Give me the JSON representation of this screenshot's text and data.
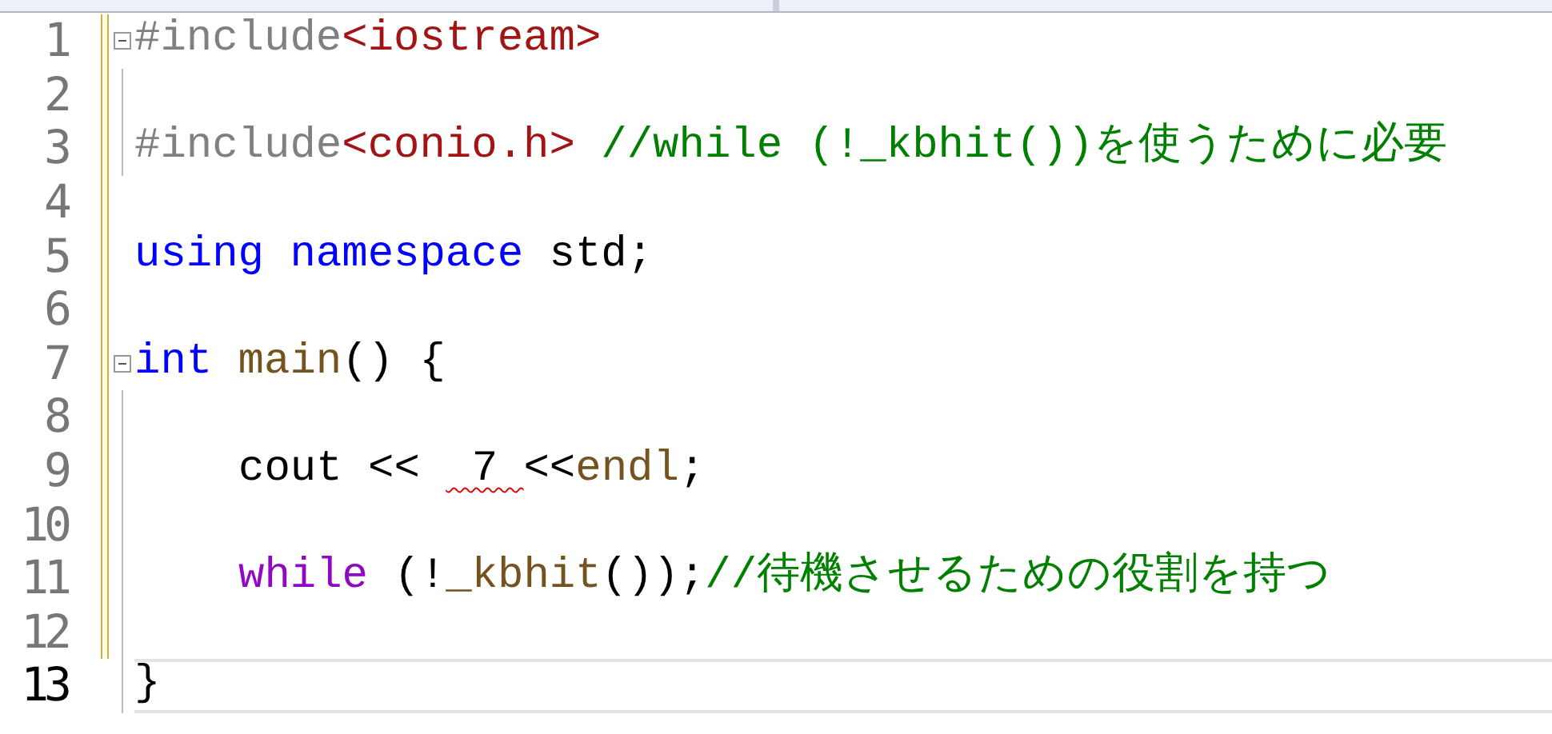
{
  "editor": {
    "lines": [
      {
        "number": "1",
        "changed": true,
        "collapsible": true,
        "current": false,
        "indented": false,
        "segments": [
          {
            "kind": "preprocessor",
            "text": "#include"
          },
          {
            "kind": "string",
            "text": "<iostream>"
          }
        ]
      },
      {
        "number": "2",
        "changed": true,
        "collapsible": false,
        "in_fold": true,
        "current": false,
        "indented": false
      },
      {
        "number": "3",
        "changed": true,
        "collapsible": false,
        "in_fold": true,
        "current": false,
        "indented": false,
        "segments": [
          {
            "kind": "preprocessor",
            "text": "#include"
          },
          {
            "kind": "string",
            "text": "<conio.h>"
          },
          {
            "kind": "comment",
            "text": " //while (!_kbhit())を使うために必要"
          }
        ]
      },
      {
        "number": "4",
        "changed": true,
        "collapsible": false,
        "in_fold": false,
        "current": false,
        "indented": false
      },
      {
        "number": "5",
        "changed": true,
        "collapsible": false,
        "in_fold": false,
        "current": false,
        "indented": false,
        "segments": [
          {
            "kind": "keyword",
            "text": "using"
          },
          {
            "kind": "keyword",
            "text": " namespace"
          },
          {
            "kind": "plain",
            "text": " std;"
          }
        ]
      },
      {
        "number": "6",
        "changed": true,
        "collapsible": false,
        "in_fold": false,
        "current": false,
        "indented": false
      },
      {
        "number": "7",
        "changed": true,
        "collapsible": true,
        "current": false,
        "indented": false,
        "segments": [
          {
            "kind": "keyword",
            "text": "int"
          },
          {
            "kind": "function",
            "text": " main"
          },
          {
            "kind": "plain",
            "text": "() {"
          }
        ]
      },
      {
        "number": "8",
        "changed": true,
        "collapsible": false,
        "in_fold": true,
        "current": false,
        "indented": false
      },
      {
        "number": "9",
        "changed": true,
        "collapsible": false,
        "in_fold": true,
        "current": false,
        "indented": true,
        "segments": [
          {
            "kind": "plain",
            "text": "cout << "
          },
          {
            "kind": "error",
            "text": " 7 "
          },
          {
            "kind": "plain",
            "text": "<<"
          },
          {
            "kind": "function",
            "text": "endl"
          },
          {
            "kind": "plain",
            "text": ";"
          }
        ]
      },
      {
        "number": "10",
        "changed": true,
        "collapsible": false,
        "in_fold": true,
        "current": false,
        "indented": false
      },
      {
        "number": "11",
        "changed": true,
        "collapsible": false,
        "in_fold": true,
        "current": false,
        "indented": true,
        "segments": [
          {
            "kind": "control",
            "text": "while"
          },
          {
            "kind": "plain",
            "text": " (!"
          },
          {
            "kind": "function",
            "text": "_kbhit"
          },
          {
            "kind": "plain",
            "text": "());"
          },
          {
            "kind": "comment",
            "text": "//待機させるための役割を持つ"
          }
        ]
      },
      {
        "number": "12",
        "changed": true,
        "collapsible": false,
        "in_fold": true,
        "current": false,
        "indented": false
      },
      {
        "number": "13",
        "changed": false,
        "collapsible": false,
        "in_fold": true,
        "current": true,
        "indented": false,
        "segments": [
          {
            "kind": "plain",
            "text": "}"
          }
        ]
      }
    ]
  }
}
